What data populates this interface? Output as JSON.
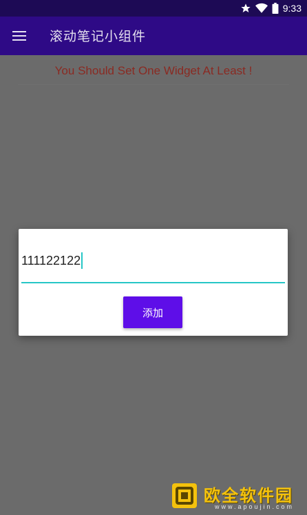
{
  "status_bar": {
    "time": "9:33",
    "icons": [
      "star-icon",
      "wifi-icon",
      "battery-icon"
    ]
  },
  "app_bar": {
    "menu_icon": "menu-icon",
    "title": "滚动笔记小组件"
  },
  "warning_text": "You Should Set One Widget At Least !",
  "dialog": {
    "input_value": "111122122",
    "add_button_label": "添加"
  },
  "watermark": {
    "cn_text": "欧全软件园",
    "url_text": "www.apoujin.com"
  },
  "colors": {
    "status_bar_bg": "#1d0a55",
    "app_bar_bg": "#2e0a86",
    "overlay_bg": "#6b6b6b",
    "warning_text": "#8a2a22",
    "accent": "#26c6c6",
    "button_bg": "#5e0ee8",
    "watermark": "#f4c20d"
  }
}
